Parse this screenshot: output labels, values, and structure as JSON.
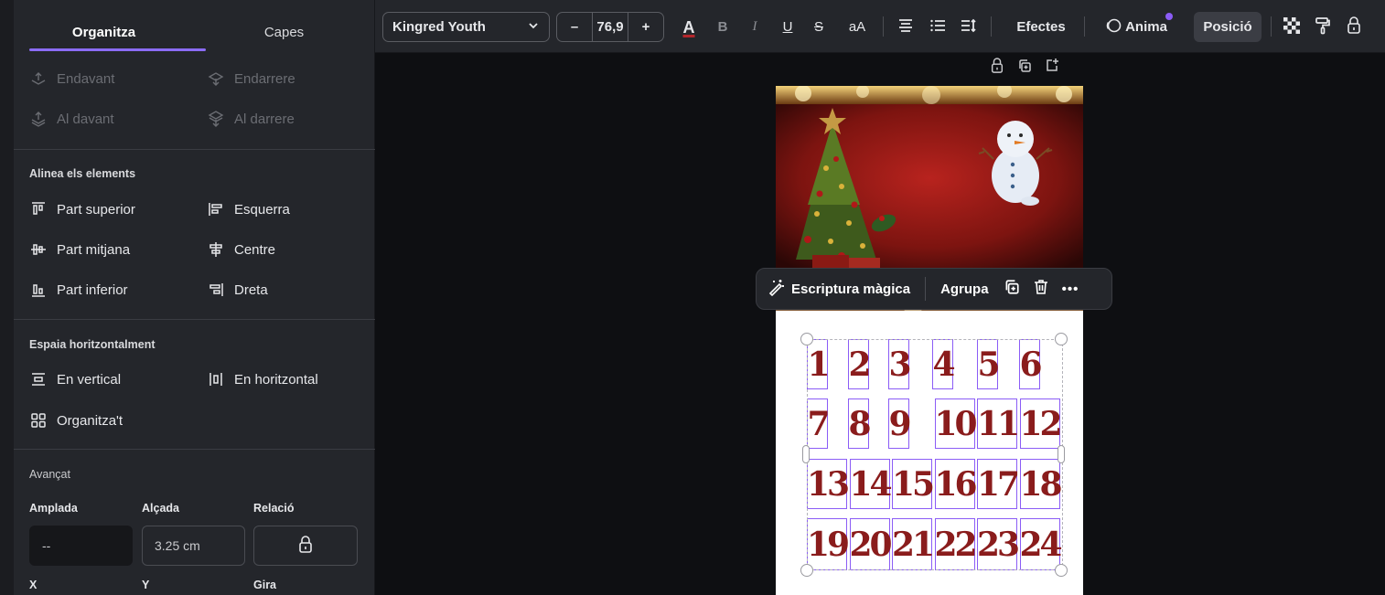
{
  "left_panel": {
    "tabs": [
      {
        "label": "Organitza",
        "active": true
      },
      {
        "label": "Capes",
        "active": false
      }
    ],
    "order": {
      "forward": "Endavant",
      "backward": "Endarrere",
      "to_front": "Al davant",
      "to_back": "Al darrere"
    },
    "align": {
      "title": "Alinea els elements",
      "top": "Part superior",
      "left": "Esquerra",
      "middle": "Part mitjana",
      "center": "Centre",
      "bottom": "Part inferior",
      "right": "Dreta"
    },
    "spacing": {
      "title": "Espaia horitzontalment",
      "vertical": "En vertical",
      "horizontal": "En horitzontal",
      "tidy": "Organitza't"
    },
    "advanced": {
      "title": "Avançat",
      "width_label": "Amplada",
      "height_label": "Alçada",
      "ratio_label": "Relació",
      "width_value": "--",
      "height_value": "3.25 cm",
      "x_label": "X",
      "y_label": "Y",
      "rotate_label": "Gira"
    }
  },
  "toolbar": {
    "font": "Kingred Youth",
    "font_size": "76,9",
    "minus": "–",
    "plus": "+",
    "case_label": "aA",
    "effects": "Efectes",
    "animate": "Anima",
    "position": "Posició",
    "text_color": "#b3262c"
  },
  "canvas": {
    "float_bar": {
      "magic_write": "Escriptura màgica",
      "group": "Agrupa"
    },
    "numbers": [
      "1",
      "2",
      "3",
      "4",
      "5",
      "6",
      "7",
      "8",
      "9",
      "10",
      "11",
      "12",
      "13",
      "14",
      "15",
      "16",
      "17",
      "18",
      "19",
      "20",
      "21",
      "22",
      "23",
      "24"
    ]
  }
}
